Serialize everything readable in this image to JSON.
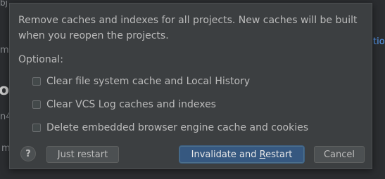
{
  "background": {
    "fragment_top_left": "bj",
    "fragment_mid_left_1": "m",
    "fragment_big_left": "ov",
    "fragment_mid_left_2": "n4",
    "fragment_low_left": "m",
    "fragment_right": "tion"
  },
  "dialog": {
    "message": "Remove caches and indexes for all projects. New caches will be built when you reopen the projects.",
    "optional_label": "Optional:",
    "options": [
      {
        "label": "Clear file system cache and Local History",
        "checked": false
      },
      {
        "label": "Clear VCS Log caches and indexes",
        "checked": false
      },
      {
        "label": "Delete embedded browser engine cache and cookies",
        "checked": false
      }
    ],
    "help_label": "?",
    "buttons": {
      "just_restart": "Just restart",
      "invalidate_prefix": "Invalidate and ",
      "invalidate_mnemonic": "R",
      "invalidate_suffix": "estart",
      "cancel": "Cancel"
    }
  },
  "colors": {
    "dialog_bg": "#3c3f41",
    "text": "#bbbbbb",
    "primary_button": "#365880",
    "secondary_button": "#4c5052"
  }
}
